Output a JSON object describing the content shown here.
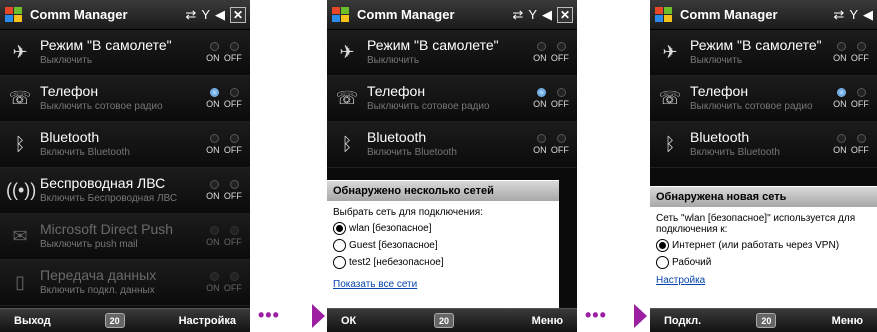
{
  "screens": [
    {
      "title": "Comm Manager",
      "rows": [
        {
          "icon": "airplane-icon",
          "glyph": "✈",
          "title": "Режим \"В самолете\"",
          "sub": "Выключить",
          "state": "off",
          "disabled": false
        },
        {
          "icon": "phone-icon",
          "glyph": "☏",
          "title": "Телефон",
          "sub": "Выключить сотовое радио",
          "state": "on",
          "disabled": false
        },
        {
          "icon": "bluetooth-icon",
          "glyph": "ᛒ",
          "title": "Bluetooth",
          "sub": "Включить Bluetooth",
          "state": "off",
          "disabled": false
        },
        {
          "icon": "wifi-icon",
          "glyph": "((•))",
          "title": "Беспроводная ЛВС",
          "sub": "Включить Беспроводная ЛВС",
          "state": "off",
          "disabled": false
        },
        {
          "icon": "push-mail-icon",
          "glyph": "✉",
          "title": "Microsoft Direct Push",
          "sub": "Выключить push mail",
          "state": "off",
          "disabled": true
        },
        {
          "icon": "data-icon",
          "glyph": "▯",
          "title": "Передача данных",
          "sub": "Включить подкл. данных",
          "state": "off",
          "disabled": true
        }
      ],
      "soft_left": "Выход",
      "soft_mid": "20",
      "soft_right": "Настройка"
    },
    {
      "title": "Comm Manager",
      "rows": [
        {
          "icon": "airplane-icon",
          "glyph": "✈",
          "title": "Режим \"В самолете\"",
          "sub": "Выключить",
          "state": "off"
        },
        {
          "icon": "phone-icon",
          "glyph": "☏",
          "title": "Телефон",
          "sub": "Выключить сотовое радио",
          "state": "on"
        },
        {
          "icon": "bluetooth-icon",
          "glyph": "ᛒ",
          "title": "Bluetooth",
          "sub": "Включить Bluetooth",
          "state": "off"
        }
      ],
      "dialog": {
        "title": "Обнаружено несколько сетей",
        "prompt": "Выбрать сеть для подключения:",
        "options": [
          "wlan [безопасное]",
          "Guest [безопасное]",
          "test2 [небезопасное]"
        ],
        "selected": 0,
        "link": "Показать все сети"
      },
      "soft_left": "ОК",
      "soft_mid": "20",
      "soft_right": "Меню"
    },
    {
      "title": "Comm Manager",
      "rows": [
        {
          "icon": "airplane-icon",
          "glyph": "✈",
          "title": "Режим \"В самолете\"",
          "sub": "Выключить",
          "state": "off"
        },
        {
          "icon": "phone-icon",
          "glyph": "☏",
          "title": "Телефон",
          "sub": "Выключить сотовое радио",
          "state": "on"
        },
        {
          "icon": "bluetooth-icon",
          "glyph": "ᛒ",
          "title": "Bluetooth",
          "sub": "Включить Bluetooth",
          "state": "off"
        }
      ],
      "dialog": {
        "title": "Обнаружена новая сеть",
        "prompt": "Сеть \"wlan [безопасное]\" используется для подключения к:",
        "options": [
          "Интернет (или работать через VPN)",
          "Рабочий"
        ],
        "selected": 0,
        "link": "Настройка"
      },
      "soft_left": "Подкл.",
      "soft_mid": "20",
      "soft_right": "Меню"
    }
  ],
  "onoff": {
    "on": "ON",
    "off": "OFF"
  },
  "status_icons": {
    "net": "⇄",
    "signal": "Y",
    "volume": "◀",
    "close": "✕"
  },
  "connector": {
    "dots": "•••"
  },
  "colors": {
    "accent": "#9b1fa0",
    "radio_on": "#3a7fd0"
  }
}
